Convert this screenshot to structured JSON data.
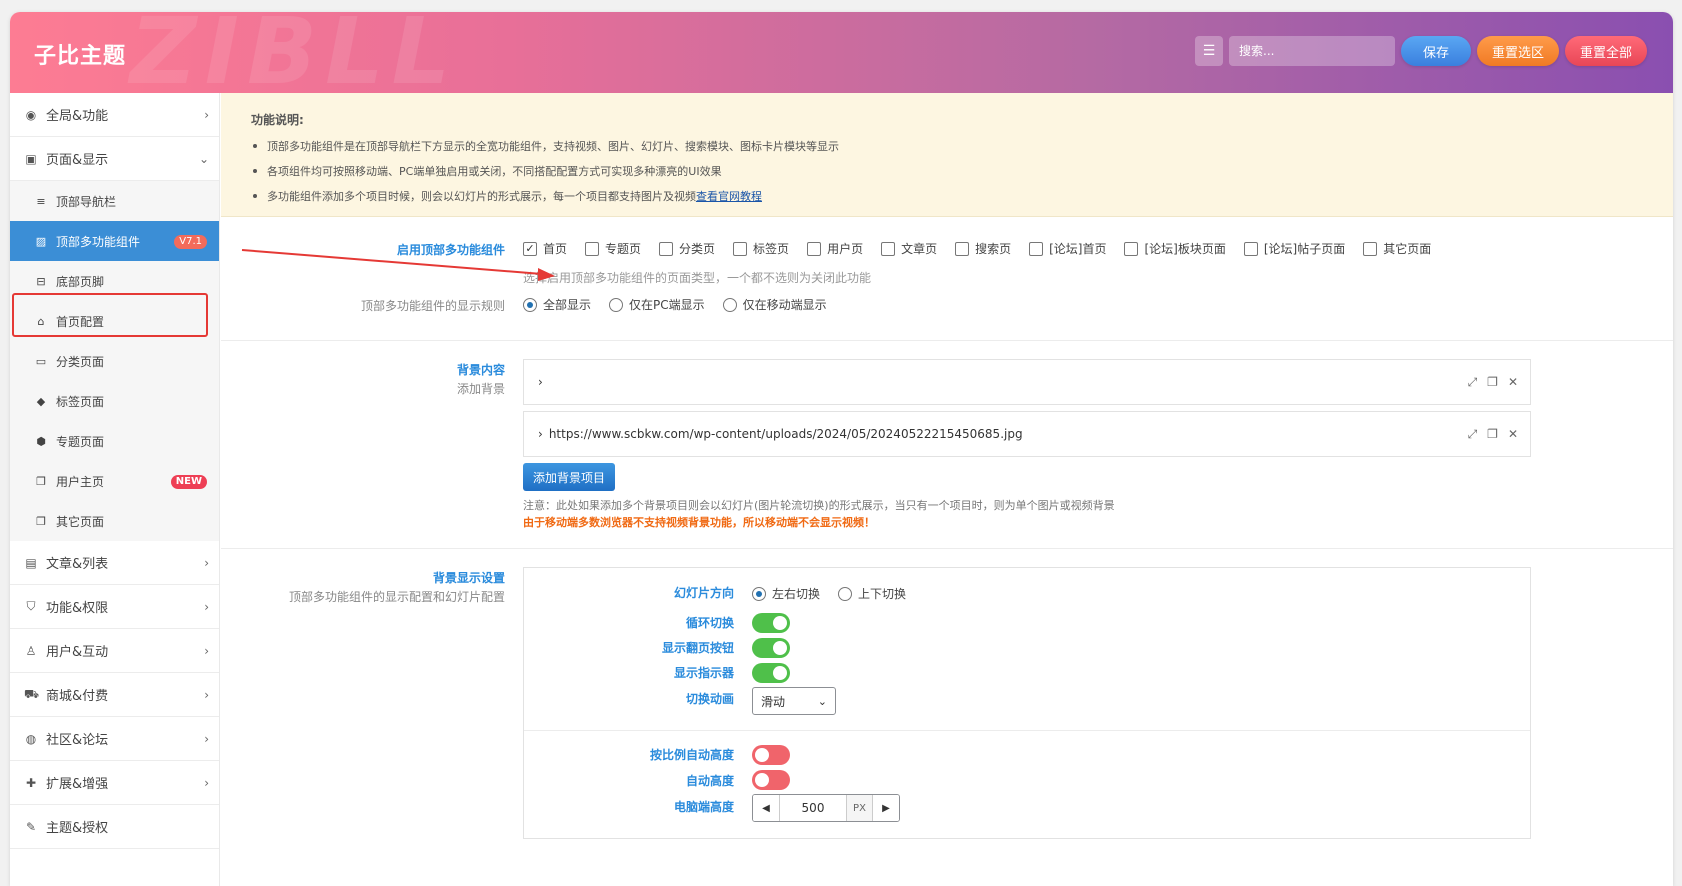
{
  "header": {
    "logo": "子比主题",
    "watermark": "ZIBLL",
    "search_placeholder": "搜索...",
    "save": "保存",
    "reset_section": "重置选区",
    "reset_all": "重置全部"
  },
  "sidebar": {
    "top1": {
      "label": "全局&功能",
      "icon": "gear-icon"
    },
    "top2": {
      "label": "页面&显示",
      "icon": "calendar-icon"
    },
    "subs": [
      {
        "label": "顶部导航栏",
        "icon": "menu-icon"
      },
      {
        "label": "顶部多功能组件",
        "icon": "image-icon",
        "badge": "V7.1"
      },
      {
        "label": "底部页脚",
        "icon": "square-icon"
      },
      {
        "label": "首页配置",
        "icon": "home-icon"
      },
      {
        "label": "分类页面",
        "icon": "folder-icon"
      },
      {
        "label": "标签页面",
        "icon": "tags-icon"
      },
      {
        "label": "专题页面",
        "icon": "cube-icon"
      },
      {
        "label": "用户主页",
        "icon": "copy-icon",
        "badge": "NEW"
      },
      {
        "label": "其它页面",
        "icon": "copy-icon"
      }
    ],
    "bottom": [
      {
        "label": "文章&列表",
        "icon": "map-icon"
      },
      {
        "label": "功能&权限",
        "icon": "shield-icon"
      },
      {
        "label": "用户&互动",
        "icon": "user-icon"
      },
      {
        "label": "商城&付费",
        "icon": "cart-icon"
      },
      {
        "label": "社区&论坛",
        "icon": "compass-icon"
      },
      {
        "label": "扩展&增强",
        "icon": "puzzle-icon"
      },
      {
        "label": "主题&授权",
        "icon": "wrench-icon"
      }
    ]
  },
  "notice": {
    "title": "功能说明:",
    "items": [
      "顶部多功能组件是在顶部导航栏下方显示的全宽功能组件，支持视频、图片、幻灯片、搜索模块、图标卡片模块等显示",
      "各项组件均可按照移动端、PC端单独启用或关闭，不同搭配配置方式可实现多种漂亮的UI效果",
      "多功能组件添加多个项目时候，则会以幻灯片的形式展示，每一个项目都支持图片及视频"
    ],
    "link": "查看官网教程"
  },
  "enable": {
    "label": "启用顶部多功能组件",
    "options": [
      "首页",
      "专题页",
      "分类页",
      "标签页",
      "用户页",
      "文章页",
      "搜索页",
      "[论坛]首页",
      "[论坛]板块页面",
      "[论坛]帖子页面",
      "其它页面"
    ],
    "hint": "选择启用顶部多功能组件的页面类型，一个都不选则为关闭此功能"
  },
  "rule": {
    "label": "顶部多功能组件的显示规则",
    "options": [
      "全部显示",
      "仅在PC端显示",
      "仅在移动端显示"
    ]
  },
  "bg": {
    "label": "背景内容",
    "sublabel": "添加背景",
    "item2": "https://www.scbkw.com/wp-content/uploads/2024/05/20240522215450685.jpg",
    "add": "添加背景项目",
    "note1": "注意：此处如果添加多个背景项目则会以幻灯片(图片轮流切换)的形式展示，当只有一个项目时，则为单个图片或视频背景",
    "note2": "由于移动端多数浏览器不支持视频背景功能，所以移动端不会显示视频！"
  },
  "display": {
    "label": "背景显示设置",
    "sublabel": "顶部多功能组件的显示配置和幻灯片配置",
    "direction_label": "幻灯片方向",
    "direction_opts": [
      "左右切换",
      "上下切换"
    ],
    "loop": "循环切换",
    "paging": "显示翻页按钮",
    "indicator": "显示指示器",
    "anim_label": "切换动画",
    "anim_value": "滑动",
    "ratio_height": "按比例自动高度",
    "auto_height": "自动高度",
    "pc_height": "电脑端高度",
    "pc_height_value": "500",
    "unit": "PX"
  }
}
